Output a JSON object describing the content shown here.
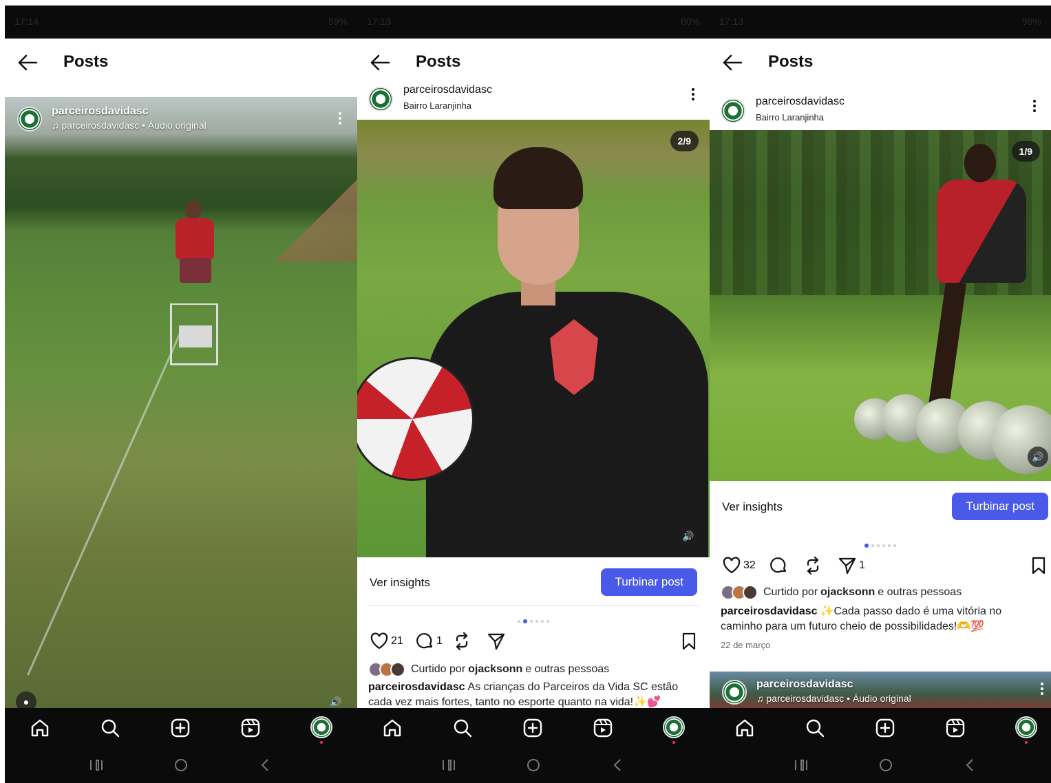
{
  "status": {
    "time1": "17:14",
    "time2": "17:13",
    "time3": "17:13",
    "battery1": "59%",
    "battery2": "60%",
    "battery3": "59%"
  },
  "header": {
    "title": "Posts"
  },
  "phone1": {
    "username": "parceirosdavidasc",
    "audio": "parceirosdavidasc • Áudio original"
  },
  "phone2": {
    "username": "parceirosdavidasc",
    "location": "Bairro Laranjinha",
    "counter": "2/9",
    "insights": "Ver insights",
    "boost": "Turbinar post",
    "likes": "21",
    "comments": "1",
    "liked_prefix": "Curtido por",
    "liked_user": "ojacksonn",
    "liked_suffix": "e outras pessoas",
    "caption_user": "parceirosdavidasc",
    "caption": "As crianças do Parceiros da Vida SC estão cada vez mais fortes, tanto no esporte quanto na vida!✨💕",
    "carousel_index": 1
  },
  "phone3": {
    "username": "parceirosdavidasc",
    "location": "Bairro Laranjinha",
    "counter": "1/9",
    "insights": "Ver insights",
    "boost": "Turbinar post",
    "likes": "32",
    "shares": "1",
    "liked_prefix": "Curtido por",
    "liked_user": "ojacksonn",
    "liked_suffix": "e outras pessoas",
    "caption_user": "parceirosdavidasc",
    "caption": "✨Cada passo dado é uma vitória no caminho para um futuro cheio de possibilidades!🫶💯",
    "date": "22 de março",
    "next_username": "parceirosdavidasc",
    "next_audio": "parceirosdavidasc • Áudio original",
    "carousel_index": 0
  },
  "nav": {
    "items": [
      "home-icon",
      "search-icon",
      "create-icon",
      "reels-icon",
      "profile-avatar"
    ]
  },
  "colors": {
    "accent": "#4a5ae8",
    "nav_bg": "#0b0b0b",
    "notification": "#e8305a"
  }
}
